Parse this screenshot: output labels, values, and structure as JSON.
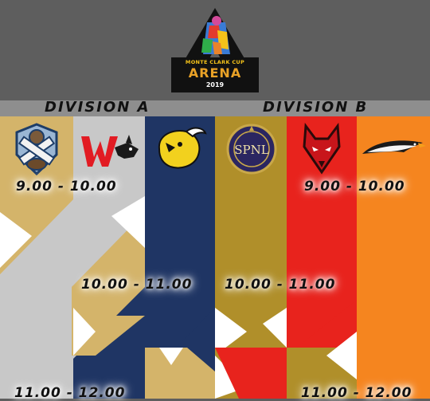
{
  "logo": {
    "line1": "MONTE CLARK CUP",
    "line2": "ARENA",
    "year": "2019"
  },
  "divisions": {
    "a": "DIVISION A",
    "b": "DIVISION B"
  },
  "teams": {
    "a1": "bears-crest-logo",
    "a2": "wolves-logo",
    "a3": "bison-logo",
    "b1": "spnl-laurel-logo",
    "b2": "red-wolf-logo",
    "b3": "eagle-logo"
  },
  "spnl_text": "SPNL",
  "times": {
    "a_900": "9.00 - 10.00",
    "b_900": "9.00 - 10.00",
    "a_1000": "10.00 - 11.00",
    "b_1000": "10.00 - 11.00",
    "a_1100": "11.00 - 12.00",
    "b_1100": "11.00 - 12.00"
  },
  "colors": {
    "background": "#5e5e5e",
    "tan": "#d4b46a",
    "silver": "#c8c8c8",
    "navy": "#1f3564",
    "gold": "#b08f2a",
    "red": "#e8231d",
    "orange": "#f5851f",
    "white": "#ffffff"
  }
}
